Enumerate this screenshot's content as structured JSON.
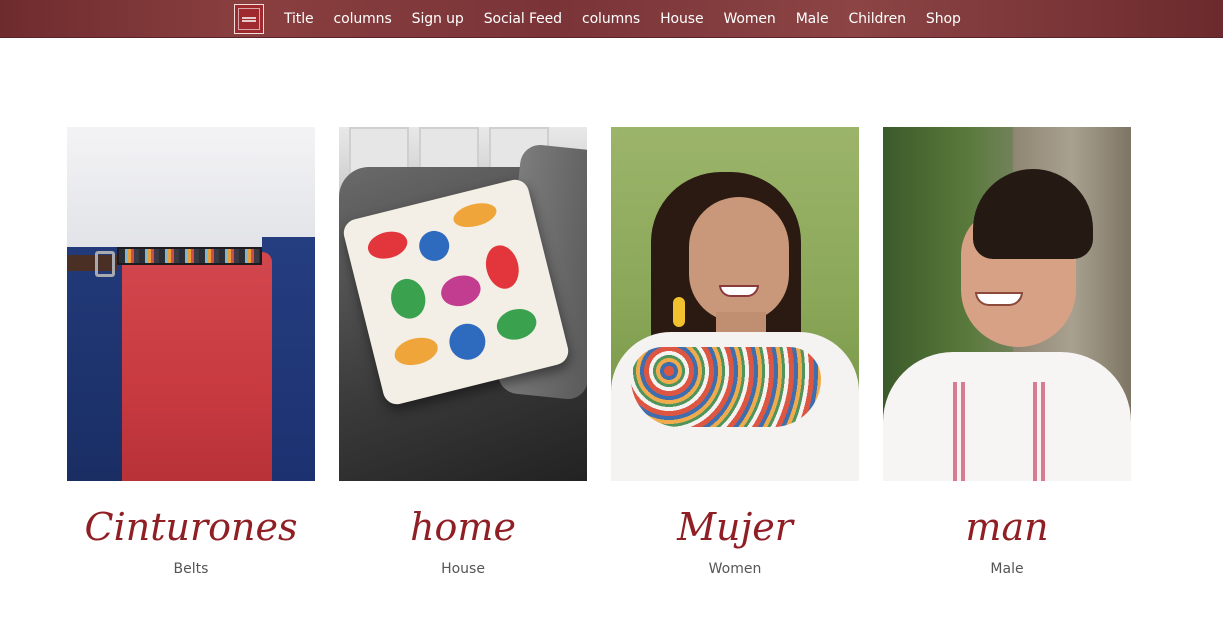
{
  "nav": {
    "logo_icon": "brand-logo-icon",
    "items": [
      "Title",
      "columns",
      "Sign up",
      "Social Feed",
      "columns",
      "House",
      "Women",
      "Male",
      "Children",
      "Shop"
    ]
  },
  "cards": [
    {
      "title": "Cinturones",
      "subtitle": "Belts",
      "image": "belts-photo"
    },
    {
      "title": "home",
      "subtitle": "House",
      "image": "embroidered-pillow-photo"
    },
    {
      "title": "Mujer",
      "subtitle": "Women",
      "image": "woman-photo"
    },
    {
      "title": "man",
      "subtitle": "Male",
      "image": "man-photo"
    }
  ],
  "colors": {
    "nav_bg": "#7a3438",
    "title_accent": "#8f1f24",
    "subtitle": "#555555"
  }
}
